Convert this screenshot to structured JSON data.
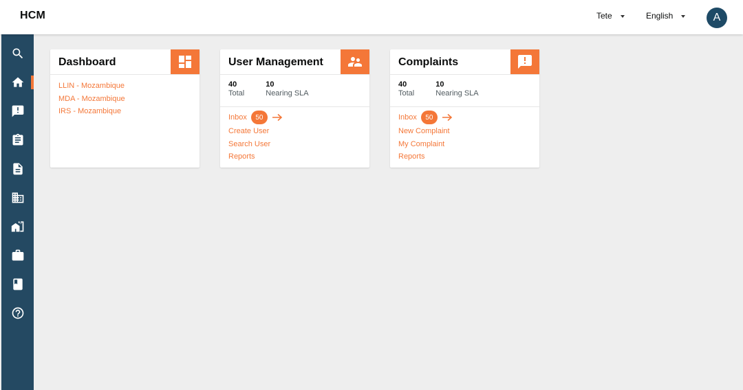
{
  "header": {
    "title": "HCM",
    "city": "Tete",
    "language": "English",
    "avatar_initial": "A"
  },
  "sidebar": {
    "items": [
      {
        "icon": "search-icon"
      },
      {
        "icon": "home-icon",
        "active": true
      },
      {
        "icon": "complaint-icon"
      },
      {
        "icon": "clipboard-icon"
      },
      {
        "icon": "document-icon"
      },
      {
        "icon": "building-icon"
      },
      {
        "icon": "house-icon"
      },
      {
        "icon": "briefcase-icon"
      },
      {
        "icon": "book-icon"
      },
      {
        "icon": "help-icon"
      }
    ]
  },
  "cards": {
    "dashboard": {
      "title": "Dashboard",
      "icon": "dashboard-icon",
      "links": [
        "LLIN - Mozambique",
        "MDA - Mozambique",
        "IRS - Mozambique"
      ]
    },
    "user_management": {
      "title": "User Management",
      "icon": "users-icon",
      "total_value": "40",
      "total_label": "Total",
      "sla_value": "10",
      "sla_label": "Nearing SLA",
      "inbox_label": "Inbox",
      "inbox_count": "50",
      "links": [
        "Create User",
        "Search User",
        "Reports"
      ]
    },
    "complaints": {
      "title": "Complaints",
      "icon": "complaint-icon",
      "total_value": "40",
      "total_label": "Total",
      "sla_value": "10",
      "sla_label": "Nearing SLA",
      "inbox_label": "Inbox",
      "inbox_count": "50",
      "links": [
        "New Complaint",
        "My Complaint",
        "Reports"
      ]
    }
  },
  "colors": {
    "accent": "#f47738",
    "sidebar": "#244962",
    "avatar": "#1e4a66",
    "background": "#eeeeee"
  }
}
